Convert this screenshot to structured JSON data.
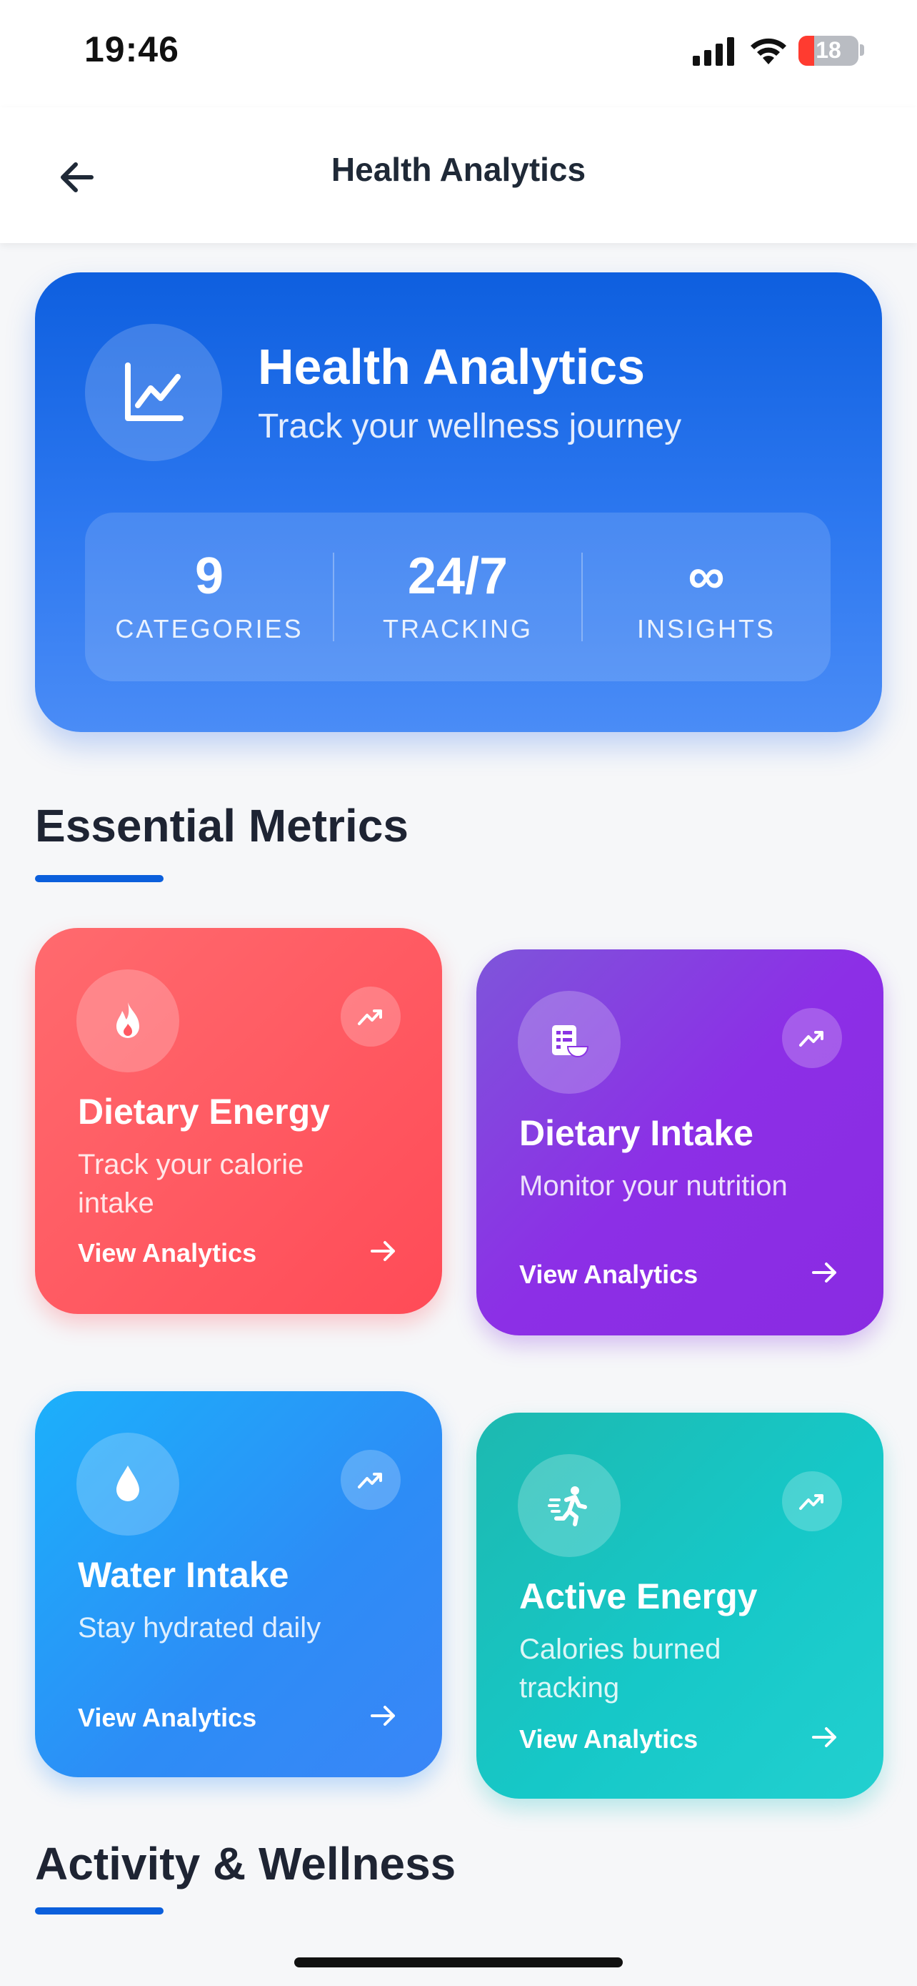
{
  "status_bar": {
    "time": "19:46",
    "battery": "18",
    "icons": [
      "signal-icon",
      "wifi-icon",
      "battery-icon"
    ]
  },
  "nav": {
    "title": "Health Analytics",
    "back_icon": "arrow-left-icon"
  },
  "hero": {
    "title": "Health Analytics",
    "subtitle": "Track your wellness journey",
    "icon": "chart-line-icon",
    "stats": [
      {
        "value": "9",
        "label": "CATEGORIES"
      },
      {
        "value": "24/7",
        "label": "TRACKING"
      },
      {
        "value": "∞",
        "label": "INSIGHTS"
      }
    ]
  },
  "sections": {
    "essential": "Essential Metrics",
    "activity": "Activity & Wellness"
  },
  "cards": [
    {
      "title": "Dietary Energy",
      "description": "Track your calorie intake",
      "link": "View Analytics",
      "icon": "flame-icon",
      "color": "#ff5a62"
    },
    {
      "title": "Dietary Intake",
      "description": "Monitor your nutrition",
      "link": "View Analytics",
      "icon": "nutrition-icon",
      "color": "#8a34e4"
    },
    {
      "title": "Water Intake",
      "description": "Stay hydrated daily",
      "link": "View Analytics",
      "icon": "water-drop-icon",
      "color": "#2d8cf6"
    },
    {
      "title": "Active Energy",
      "description": "Calories burned tracking",
      "link": "View Analytics",
      "icon": "running-icon",
      "color": "#18c6c4"
    }
  ],
  "colors": {
    "accent": "#0b5fdc",
    "background": "#f6f7f9"
  }
}
